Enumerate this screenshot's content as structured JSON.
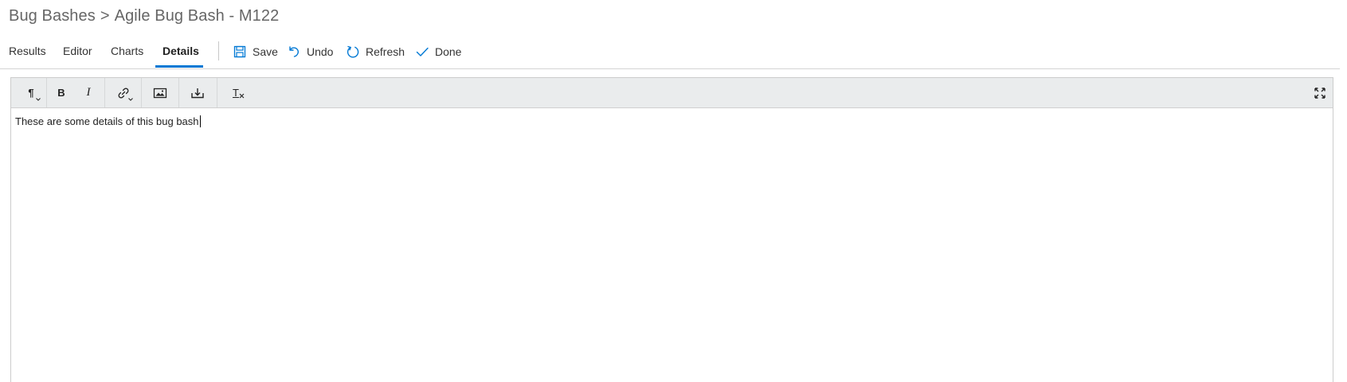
{
  "breadcrumb": {
    "parent": "Bug Bashes",
    "separator": ">",
    "current": "Agile Bug Bash - M122"
  },
  "tabs": [
    {
      "label": "Results",
      "active": false
    },
    {
      "label": "Editor",
      "active": false
    },
    {
      "label": "Charts",
      "active": false
    },
    {
      "label": "Details",
      "active": true
    }
  ],
  "commands": {
    "save": {
      "label": "Save",
      "icon": "save-icon"
    },
    "undo": {
      "label": "Undo",
      "icon": "undo-icon"
    },
    "refresh": {
      "label": "Refresh",
      "icon": "refresh-icon"
    },
    "done": {
      "label": "Done",
      "icon": "check-icon"
    }
  },
  "toolbar": {
    "items": [
      "paragraph-format",
      "bold",
      "italic",
      "link",
      "image",
      "insert-file",
      "clear-formatting",
      "fullscreen"
    ],
    "bold_label": "B",
    "italic_label": "I",
    "paragraph_label": "¶",
    "clear_label": "T"
  },
  "editor": {
    "text": "These are some details of this bug bash"
  },
  "colors": {
    "accent": "#0078d4",
    "toolbar_bg": "#eaeced",
    "command_icon": "#0078d4"
  }
}
